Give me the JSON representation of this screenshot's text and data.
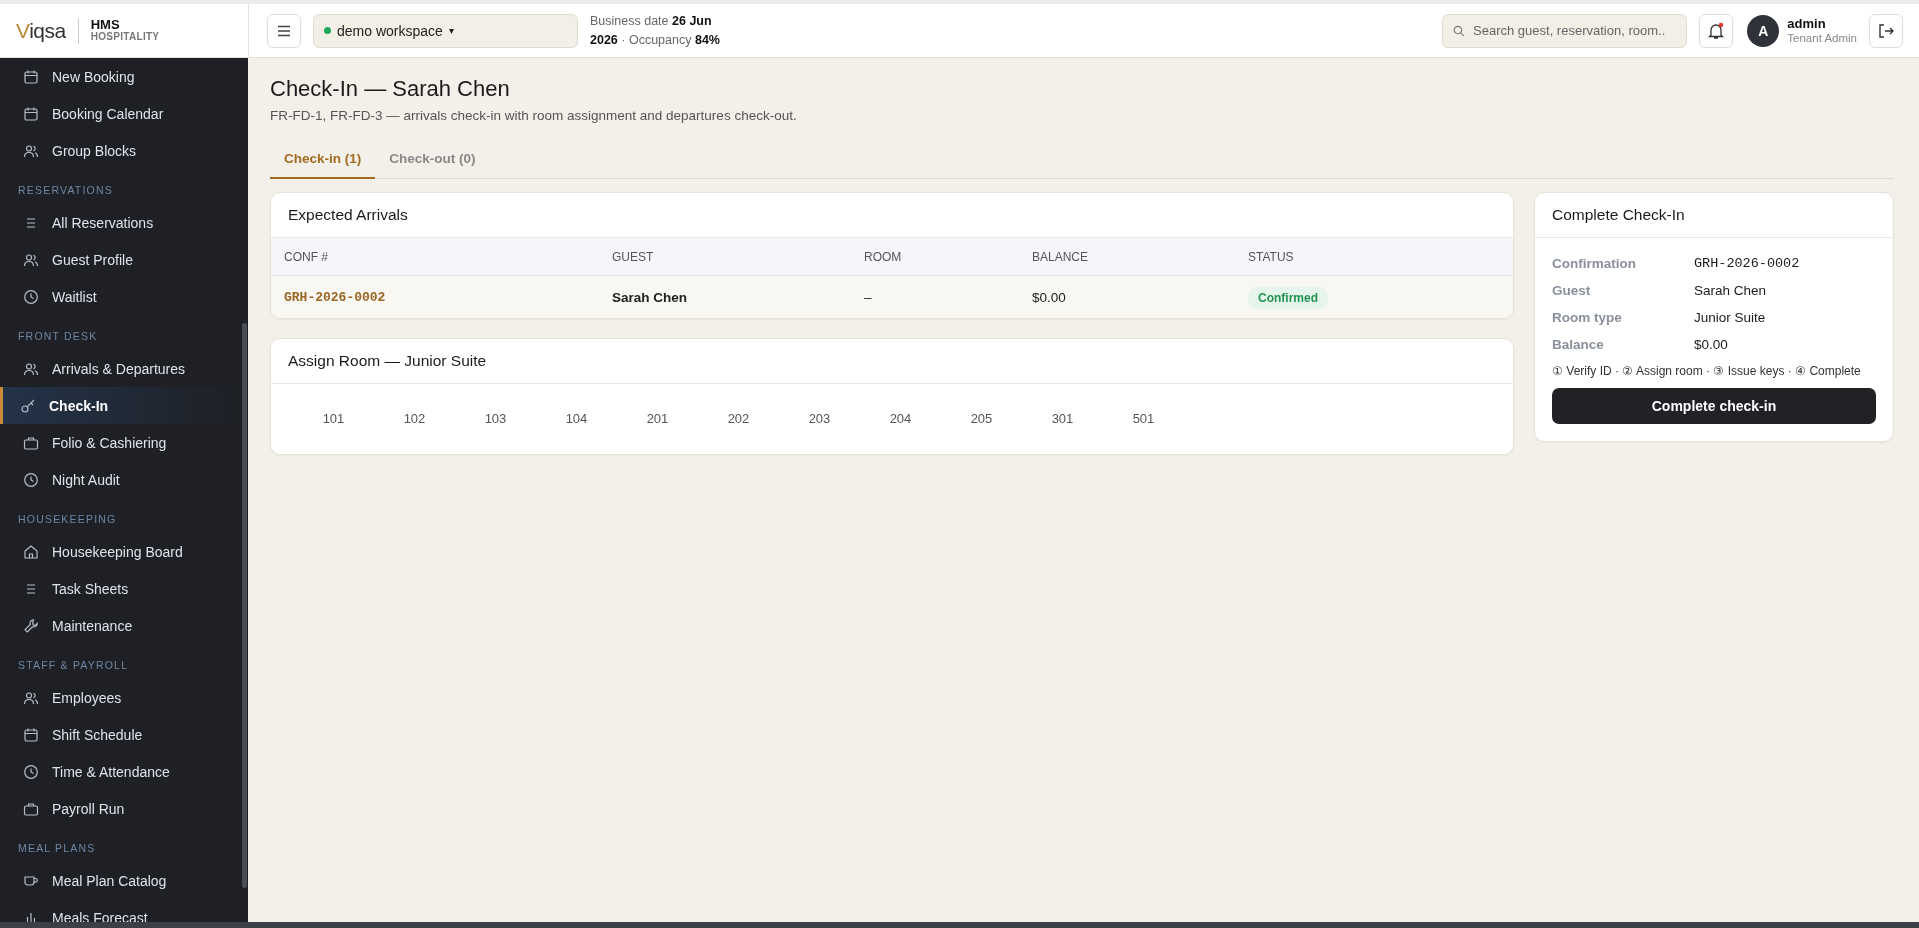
{
  "brand": {
    "logo": "Viqsa",
    "product": "HMS",
    "subtitle": "HOSPITALITY"
  },
  "topbar": {
    "workspace": "demo workspace",
    "workspace_caret": "▾",
    "business_date_label": "Business date",
    "business_date": "26 Jun 2026",
    "separator": "·",
    "occupancy_label": "Occupancy",
    "occupancy": "84%",
    "search": {
      "placeholder": "Search guest, reservation, room.."
    },
    "notifications_unread": true,
    "user": {
      "initial": "A",
      "name": "admin",
      "role": "Tenant Admin"
    }
  },
  "sidebar": {
    "sections": [
      {
        "items": [
          {
            "label": "New Booking",
            "selected": false
          },
          {
            "label": "Booking Calendar",
            "selected": false
          },
          {
            "label": "Group Blocks",
            "selected": false
          }
        ]
      },
      {
        "title": "RESERVATIONS",
        "items": [
          {
            "label": "All Reservations",
            "selected": false
          },
          {
            "label": "Guest Profile",
            "selected": false
          },
          {
            "label": "Waitlist",
            "selected": false
          }
        ]
      },
      {
        "title": "FRONT DESK",
        "items": [
          {
            "label": "Arrivals & Departures",
            "selected": false
          },
          {
            "label": "Check-In",
            "selected": true
          },
          {
            "label": "Folio & Cashiering",
            "selected": false
          },
          {
            "label": "Night Audit",
            "selected": false
          }
        ]
      },
      {
        "title": "HOUSEKEEPING",
        "items": [
          {
            "label": "Housekeeping Board",
            "selected": false
          },
          {
            "label": "Task Sheets",
            "selected": false
          },
          {
            "label": "Maintenance",
            "selected": false
          }
        ]
      },
      {
        "title": "STAFF & PAYROLL",
        "items": [
          {
            "label": "Employees",
            "selected": false
          },
          {
            "label": "Shift Schedule",
            "selected": false
          },
          {
            "label": "Time & Attendance",
            "selected": false
          },
          {
            "label": "Payroll Run",
            "selected": false
          }
        ]
      },
      {
        "title": "MEAL PLANS",
        "items": [
          {
            "label": "Meal Plan Catalog",
            "selected": false
          },
          {
            "label": "Meals Forecast",
            "selected": false
          }
        ]
      }
    ]
  },
  "page": {
    "title": "Check-In — Sarah Chen",
    "subtitle": "FR-FD-1, FR-FD-3 — arrivals check-in with room assignment and departures check-out."
  },
  "tabs": [
    {
      "label": "Check-in (1)",
      "selected": true
    },
    {
      "label": "Check-out (0)",
      "selected": false
    }
  ],
  "arrivals": {
    "title": "Expected Arrivals",
    "columns": [
      "CONF #",
      "GUEST",
      "ROOM",
      "BALANCE",
      "STATUS"
    ],
    "rows": [
      {
        "conf": "GRH-2026-0002",
        "guest": "Sarah Chen",
        "room": "–",
        "balance": "$0.00",
        "status": "Confirmed",
        "selected": true
      }
    ]
  },
  "assign_room": {
    "title": "Assign Room — Junior Suite",
    "rooms": [
      "101",
      "102",
      "103",
      "104",
      "201",
      "202",
      "203",
      "204",
      "205",
      "301",
      "501"
    ]
  },
  "complete": {
    "title": "Complete Check-In",
    "fields": [
      {
        "label": "Confirmation",
        "value": "GRH-2026-0002",
        "kind": "mono"
      },
      {
        "label": "Guest",
        "value": "Sarah Chen",
        "kind": "text"
      },
      {
        "label": "Room type",
        "value": "Junior Suite",
        "kind": "text"
      },
      {
        "label": "Balance",
        "value": "$0.00",
        "kind": "text"
      }
    ],
    "steps": "① Verify ID · ② Assign room · ③ Issue keys · ④ Complete",
    "button": "Complete check-in"
  }
}
